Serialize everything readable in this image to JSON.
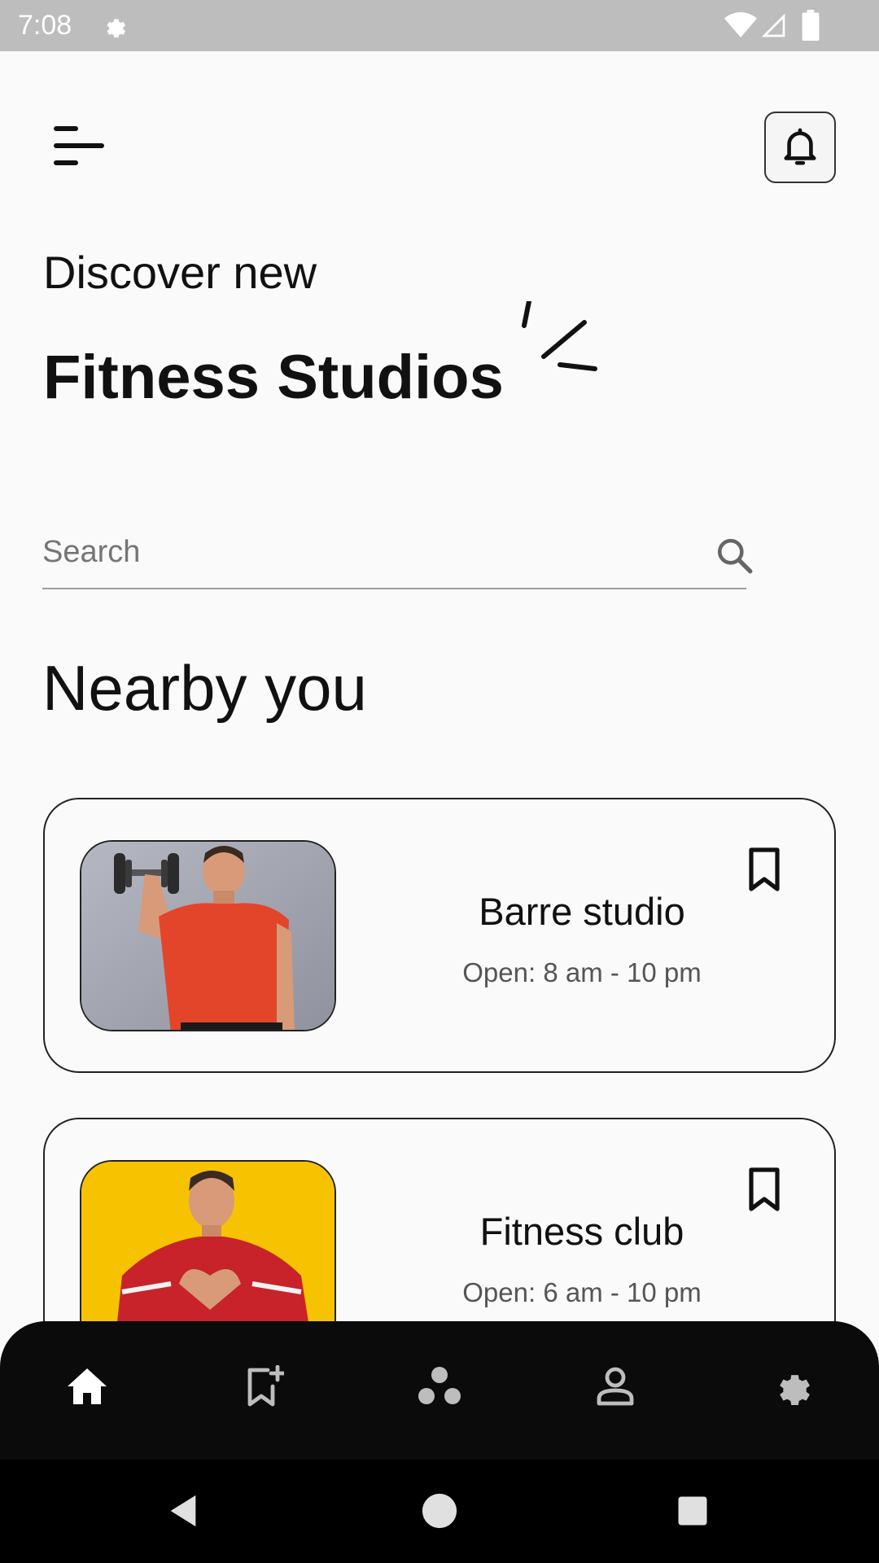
{
  "status_bar": {
    "time": "7:08",
    "icons": [
      "gear-icon",
      "wifi-icon",
      "signal-icon",
      "battery-icon"
    ]
  },
  "header": {
    "menu_icon": "menu-icon",
    "notification_icon": "bell-icon",
    "headline_light": "Discover new",
    "headline_bold": "Fitness Studios"
  },
  "search": {
    "placeholder": "Search",
    "value": "",
    "icon": "search-icon"
  },
  "nearby": {
    "title": "Nearby you",
    "studios": [
      {
        "name": "Barre studio",
        "hours": "Open: 8 am - 10 pm",
        "photo": "man lifting dumbbell, red t-shirt",
        "bookmark_icon": "bookmark-icon"
      },
      {
        "name": "Fitness club",
        "hours": "Open: 6 am - 10 pm",
        "photo": "man making heart hands, red jacket, yellow background",
        "bookmark_icon": "bookmark-icon"
      }
    ]
  },
  "bottom_nav": {
    "items": [
      {
        "id": "home",
        "icon": "home-icon",
        "active": true
      },
      {
        "id": "bookmarks",
        "icon": "bookmark-add-icon",
        "active": false
      },
      {
        "id": "community",
        "icon": "group-dots-icon",
        "active": false
      },
      {
        "id": "profile",
        "icon": "person-icon",
        "active": false
      },
      {
        "id": "settings",
        "icon": "settings-icon",
        "active": false
      }
    ]
  },
  "system_nav": {
    "buttons": [
      "back-icon",
      "home-circle-icon",
      "recents-icon"
    ]
  },
  "colors": {
    "background": "#fafafa",
    "text": "#111111",
    "muted_text": "#555555",
    "nav_background": "#0b0b0b",
    "nav_active": "#ffffff",
    "nav_inactive": "#bdbdbd",
    "status_bar": "#bdbdbd",
    "card2_photo_bg": "#f7c300"
  }
}
